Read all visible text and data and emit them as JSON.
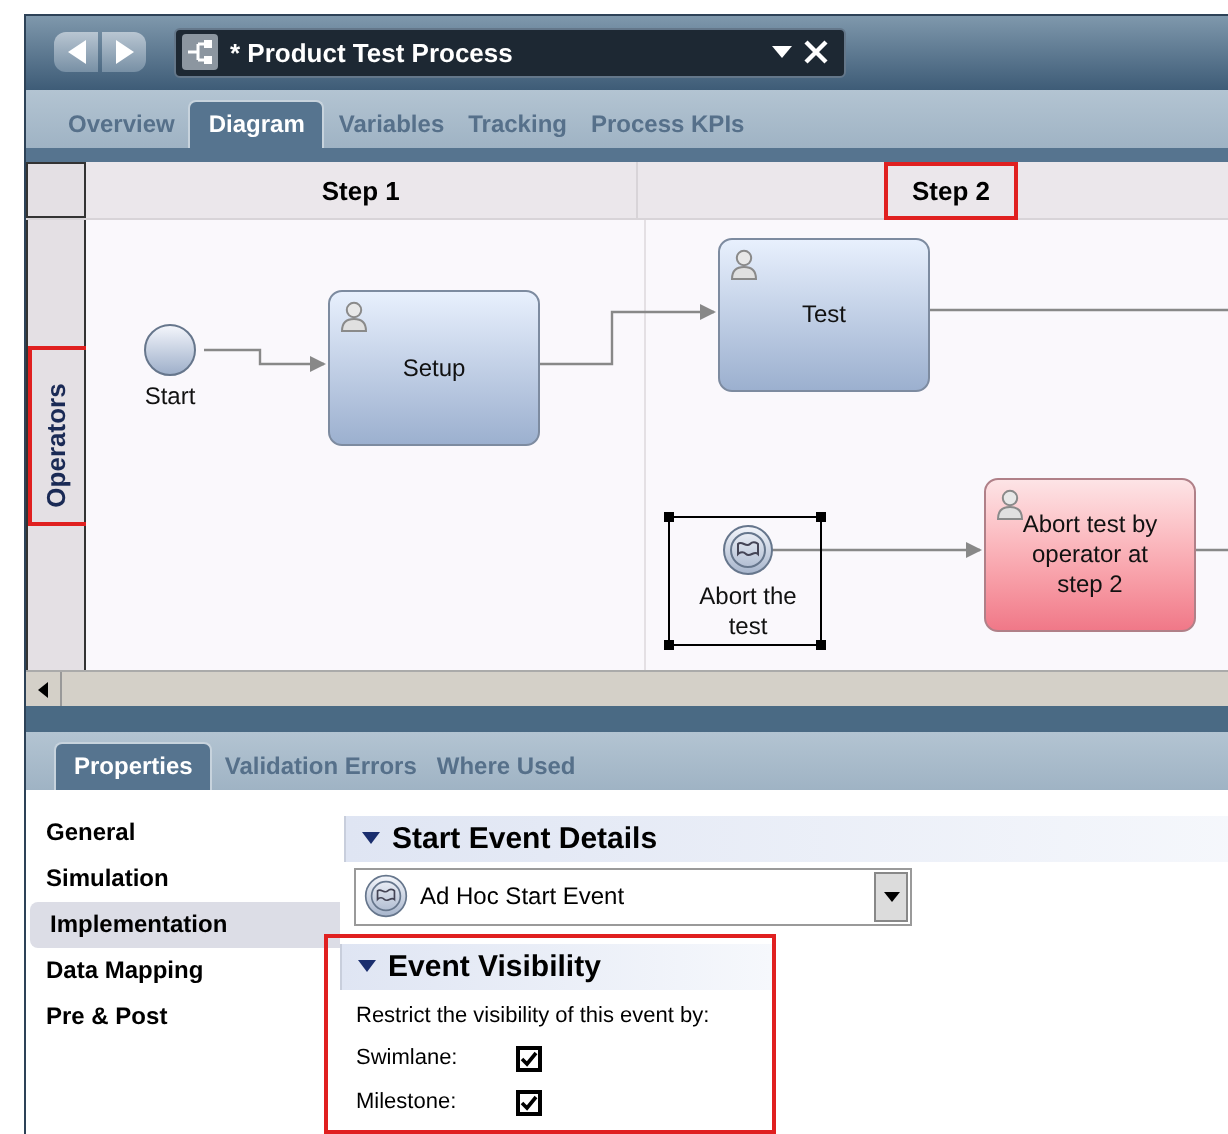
{
  "editor": {
    "title": "* Product Test Process"
  },
  "tabs": [
    {
      "label": "Overview",
      "selected": false
    },
    {
      "label": "Diagram",
      "selected": true
    },
    {
      "label": "Variables",
      "selected": false
    },
    {
      "label": "Tracking",
      "selected": false
    },
    {
      "label": "Process KPIs",
      "selected": false
    }
  ],
  "diagram": {
    "milestones": [
      {
        "label": "Step 1",
        "highlighted": false
      },
      {
        "label": "Step 2",
        "highlighted": true
      }
    ],
    "lane": {
      "label": "Operators",
      "highlighted": true
    },
    "nodes": [
      {
        "kind": "start",
        "label": "Start",
        "selected": false
      },
      {
        "kind": "task",
        "label": "Setup",
        "selected": false
      },
      {
        "kind": "task",
        "label": "Test",
        "selected": false
      },
      {
        "kind": "adhoc",
        "label": "Abort the test",
        "selected": true
      },
      {
        "kind": "alert_task",
        "label": "Abort test by operator at step 2",
        "selected": false
      }
    ]
  },
  "properties_tabs": [
    {
      "label": "Properties",
      "selected": true
    },
    {
      "label": "Validation Errors",
      "selected": false
    },
    {
      "label": "Where Used",
      "selected": false
    }
  ],
  "nav": [
    {
      "label": "General",
      "selected": false
    },
    {
      "label": "Simulation",
      "selected": false
    },
    {
      "label": "Implementation",
      "selected": true
    },
    {
      "label": "Data Mapping",
      "selected": false
    },
    {
      "label": "Pre & Post",
      "selected": false
    }
  ],
  "start_event_details": {
    "title": "Start Event Details",
    "highlighted": false,
    "event_type": "Ad Hoc Start Event"
  },
  "event_visibility": {
    "title": "Event Visibility",
    "highlighted": true,
    "hint": "Restrict the visibility of this event by:",
    "options": [
      {
        "label": "Swimlane:",
        "checked": true
      },
      {
        "label": "Milestone:",
        "checked": true
      }
    ]
  }
}
